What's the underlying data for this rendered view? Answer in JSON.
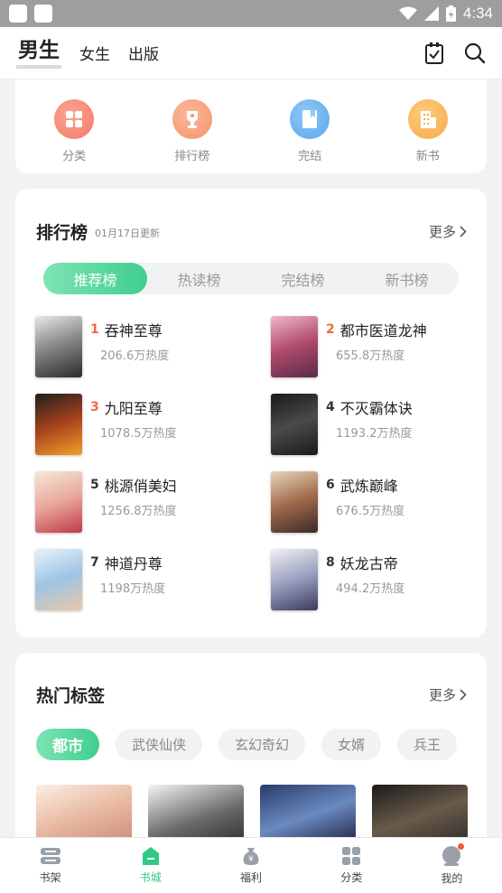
{
  "status_bar": {
    "time": "4:34"
  },
  "header": {
    "tabs": [
      {
        "label": "男生",
        "active": true
      },
      {
        "label": "女生",
        "active": false
      },
      {
        "label": "出版",
        "active": false
      }
    ],
    "icons": [
      "checklist-icon",
      "search-icon"
    ]
  },
  "categories": [
    {
      "label": "分类",
      "icon": "grid-icon",
      "color": "#f7826e"
    },
    {
      "label": "排行榜",
      "icon": "trophy-icon",
      "color": "#f8a07a"
    },
    {
      "label": "完结",
      "icon": "bookmark-icon",
      "color": "#6cb3f1"
    },
    {
      "label": "新书",
      "icon": "building-icon",
      "color": "#f7b65b"
    }
  ],
  "ranking": {
    "title": "排行榜",
    "updated": "01月17日更新",
    "more": "更多",
    "tabs": [
      {
        "label": "推荐榜",
        "active": true
      },
      {
        "label": "热读榜",
        "active": false
      },
      {
        "label": "完结榜",
        "active": false
      },
      {
        "label": "新书榜",
        "active": false
      }
    ],
    "books": [
      {
        "rank": "1",
        "title": "吞神至尊",
        "heat": "206.6万热度"
      },
      {
        "rank": "2",
        "title": "都市医道龙神",
        "heat": "655.8万热度"
      },
      {
        "rank": "3",
        "title": "九阳至尊",
        "heat": "1078.5万热度"
      },
      {
        "rank": "4",
        "title": "不灭霸体诀",
        "heat": "1193.2万热度"
      },
      {
        "rank": "5",
        "title": "桃源俏美妇",
        "heat": "1256.8万热度"
      },
      {
        "rank": "6",
        "title": "武炼巅峰",
        "heat": "676.5万热度"
      },
      {
        "rank": "7",
        "title": "神道丹尊",
        "heat": "1198万热度"
      },
      {
        "rank": "8",
        "title": "妖龙古帝",
        "heat": "494.2万热度"
      }
    ],
    "rank_colors": {
      "top3": "#f26b3a",
      "rest": "#333333"
    }
  },
  "hot_tags": {
    "title": "热门标签",
    "more": "更多",
    "tags": [
      {
        "label": "都市",
        "active": true
      },
      {
        "label": "武侠仙侠",
        "active": false
      },
      {
        "label": "玄幻奇幻",
        "active": false
      },
      {
        "label": "女婿",
        "active": false
      },
      {
        "label": "兵王",
        "active": false
      }
    ]
  },
  "bottom_nav": [
    {
      "label": "书架",
      "icon": "bookshelf-icon",
      "active": false
    },
    {
      "label": "书城",
      "icon": "store-icon",
      "active": true
    },
    {
      "label": "福利",
      "icon": "moneybag-icon",
      "active": false
    },
    {
      "label": "分类",
      "icon": "grid-icon",
      "active": false
    },
    {
      "label": "我的",
      "icon": "profile-icon",
      "active": false
    }
  ],
  "colors": {
    "accent": "#3ecf8e",
    "rank_highlight": "#f26b3a"
  }
}
